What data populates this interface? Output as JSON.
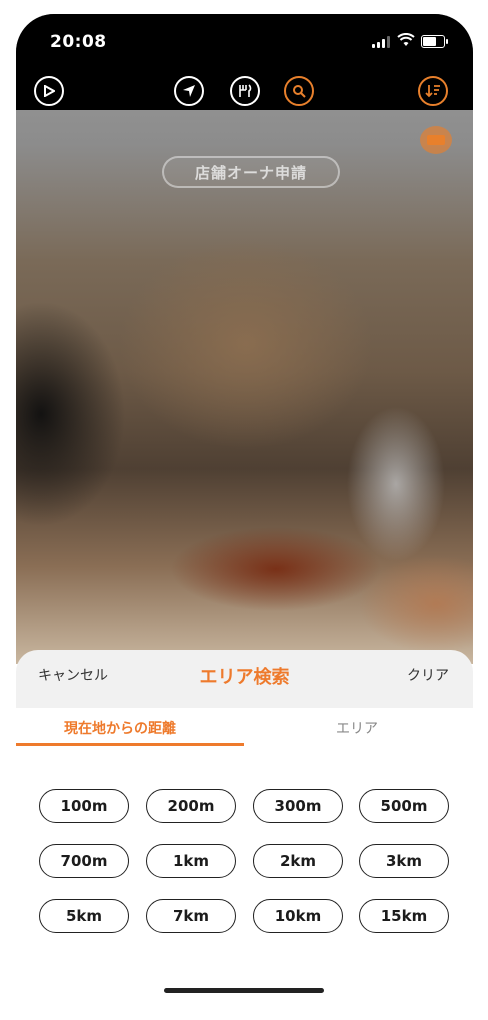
{
  "status_bar": {
    "time": "20:08",
    "battery_level": 0.75
  },
  "nav": {
    "icons": [
      "play-circle-icon",
      "location-arrow-icon",
      "restaurant-icon",
      "search-icon",
      "sort-filter-icon"
    ]
  },
  "owner_button": {
    "label": "店舗オーナ申請"
  },
  "sheet": {
    "cancel_label": "キャンセル",
    "title": "エリア検索",
    "clear_label": "クリア"
  },
  "tabs": [
    {
      "label": "現在地からの距離",
      "active": true
    },
    {
      "label": "エリア",
      "active": false
    }
  ],
  "distances": [
    "100m",
    "200m",
    "300m",
    "500m",
    "700m",
    "1km",
    "2km",
    "3km",
    "5km",
    "7km",
    "10km",
    "15km"
  ],
  "colors": {
    "accent": "#ee7a2c",
    "chip_border": "#222222",
    "header_bg": "#f1f1f1"
  }
}
